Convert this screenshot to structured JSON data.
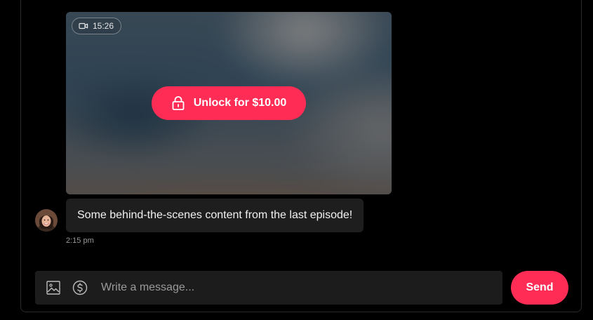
{
  "media": {
    "duration": "15:26",
    "duration_icon": "video-camera-icon",
    "unlock_label": "Unlock for $10.00",
    "unlock_icon": "lock-icon"
  },
  "message": {
    "text": "Some behind-the-scenes content from the last episode!",
    "time": "2:15 pm",
    "avatar_icon": "avatar"
  },
  "composer": {
    "placeholder": "Write a message...",
    "image_icon": "image-icon",
    "tip_icon": "dollar-circle-icon",
    "send_label": "Send"
  },
  "colors": {
    "accent": "#ff2d55",
    "background": "#000000",
    "bubble": "#1e1e1e",
    "composer": "#1c1c1c"
  }
}
